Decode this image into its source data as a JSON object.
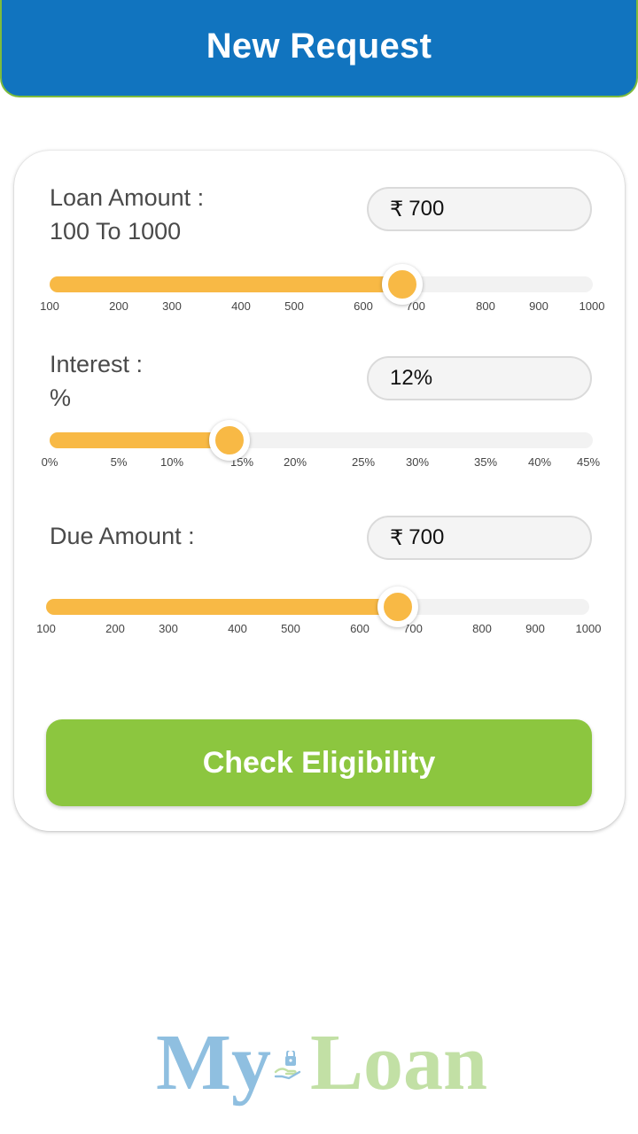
{
  "header": {
    "title": "New Request"
  },
  "loan_amount": {
    "label_line1": "Loan Amount :",
    "label_line2": "100 To 1000",
    "currency_symbol": "₹",
    "value": "700",
    "slider_value": 700,
    "min": 100,
    "max": 1000,
    "ticks": [
      "100",
      "200",
      "300",
      "400",
      "500",
      "600",
      "700",
      "800",
      "900",
      "1000"
    ]
  },
  "interest": {
    "label_line1": "Interest :",
    "label_line2": "%",
    "value": "12%",
    "slider_value": 12,
    "min": 0,
    "max": 45,
    "ticks": [
      "0%",
      "5%",
      "10%",
      "15%",
      "20%",
      "25%",
      "30%",
      "35%",
      "40%",
      "45%"
    ]
  },
  "due_amount": {
    "label": "Due Amount :",
    "currency_symbol": "₹",
    "value": "700",
    "slider_value": 700,
    "min": 100,
    "max": 1000,
    "ticks": [
      "100",
      "200",
      "300",
      "400",
      "500",
      "600",
      "700",
      "800",
      "900",
      "1000"
    ]
  },
  "check_button": {
    "label": "Check Eligibility"
  },
  "logo": {
    "part1": "My",
    "part2": "Loan"
  },
  "colors": {
    "header_bg": "#1174bf",
    "accent_yellow": "#f8b945",
    "button_green": "#8cc63f",
    "track_grey": "#f2f2f2"
  }
}
